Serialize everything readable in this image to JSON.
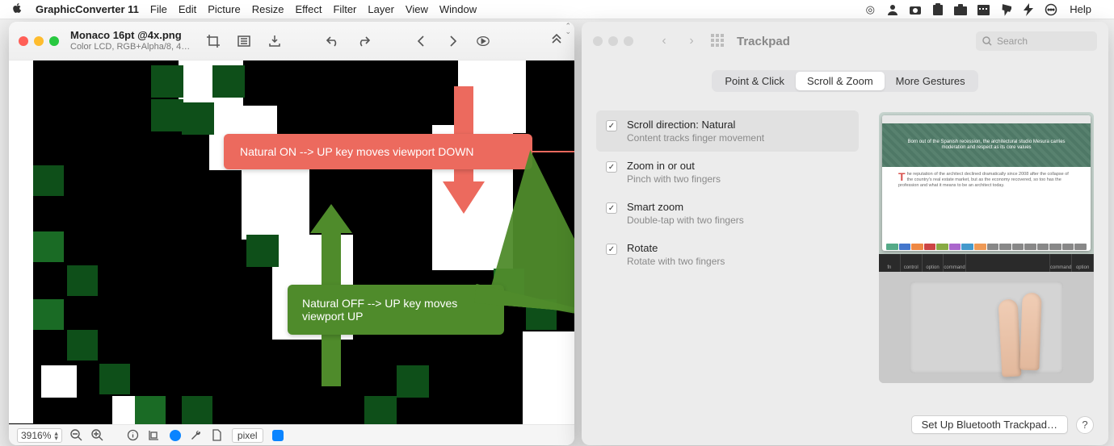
{
  "menubar": {
    "app": "GraphicConverter 11",
    "items": [
      "File",
      "Edit",
      "Picture",
      "Resize",
      "Effect",
      "Filter",
      "Layer",
      "View",
      "Window"
    ],
    "right_items": [
      "target",
      "user",
      "camera",
      "clipboard",
      "case",
      "calendar",
      "pin",
      "bolt",
      "more"
    ],
    "help": "Help"
  },
  "gc_window": {
    "title": "Monaco 16pt @4x.png",
    "subtitle": "Color LCD, RGB+Alpha/8, 4…",
    "zoom_value": "3916%",
    "unit_value": "pixel",
    "callout_red": "Natural ON --> UP key moves viewport DOWN",
    "callout_green": "Natural OFF --> UP key moves viewport UP"
  },
  "prefs_window": {
    "title": "Trackpad",
    "search_placeholder": "Search",
    "tabs": [
      "Point & Click",
      "Scroll & Zoom",
      "More Gestures"
    ],
    "active_tab_index": 1,
    "options": [
      {
        "label": "Scroll direction: Natural",
        "sub": "Content tracks finger movement",
        "checked": true
      },
      {
        "label": "Zoom in or out",
        "sub": "Pinch with two fingers",
        "checked": true
      },
      {
        "label": "Smart zoom",
        "sub": "Double-tap with two fingers",
        "checked": true
      },
      {
        "label": "Rotate",
        "sub": "Rotate with two fingers",
        "checked": true
      }
    ],
    "preview_hero": "Born out of the Spanish recession, the architectural studio Mesura carries moderation and respect as its core values",
    "preview_article": "he reputation of the architect declined dramatically since 2008 after the collapse of the country's real estate market, but as the economy recovered, so too has the profession and what it means to be an architect today.",
    "bt_button": "Set Up Bluetooth Trackpad…",
    "keys": [
      "fn",
      "control",
      "option",
      "command",
      "",
      "",
      "",
      "",
      "command",
      "option"
    ]
  }
}
